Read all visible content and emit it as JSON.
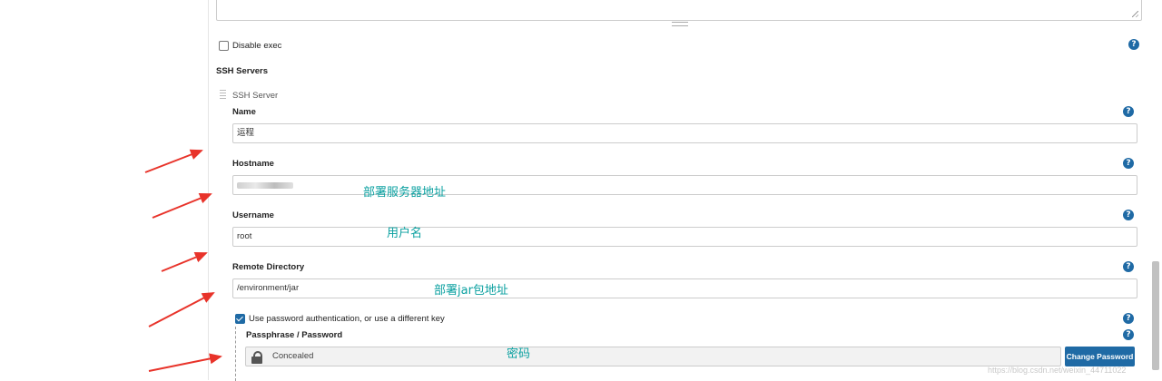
{
  "disable_exec": {
    "label": "Disable exec",
    "checked": false
  },
  "ssh_servers": {
    "section_title": "SSH Servers",
    "server_title": "SSH Server",
    "name": {
      "label": "Name",
      "value": "运程"
    },
    "hostname": {
      "label": "Hostname",
      "value": ""
    },
    "username": {
      "label": "Username",
      "value": "root"
    },
    "remote_directory": {
      "label": "Remote Directory",
      "value": "/environment/jar"
    },
    "use_password": {
      "label": "Use password authentication, or use a different key",
      "checked": true
    },
    "passphrase": {
      "label": "Passphrase / Password",
      "value": "Concealed",
      "change_label": "Change Password"
    }
  },
  "help": {
    "symbol": "?"
  },
  "annotations": {
    "hostname_note": "部署服务器地址",
    "username_note": "用户名",
    "directory_note": "部署jar包地址",
    "password_note": "密码"
  },
  "watermark": "https://blog.csdn.net/weixin_44711022",
  "colors": {
    "accent": "#1f6aa5",
    "annotation": "#0aa0a0",
    "arrow": "#e8332a"
  }
}
